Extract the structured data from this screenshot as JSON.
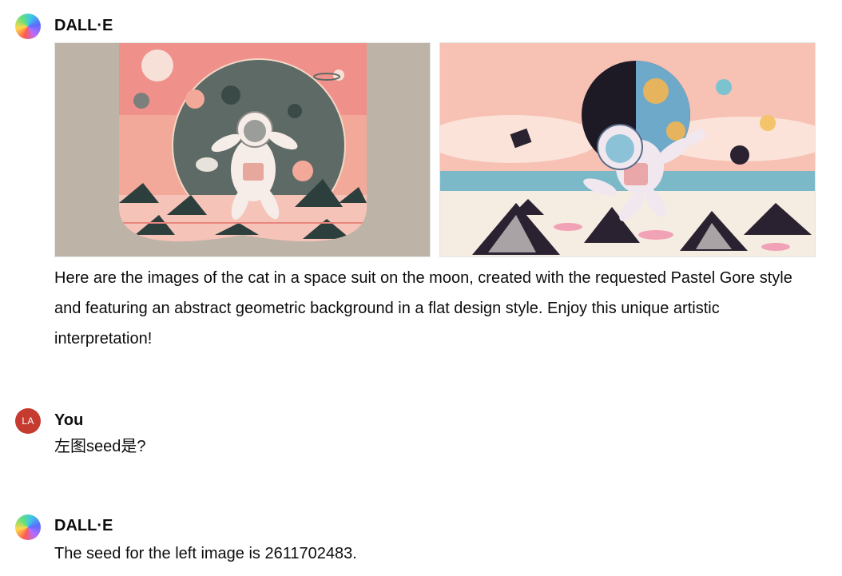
{
  "messages": [
    {
      "author": "DALL·E",
      "avatar_icon": "dalle-avatar-icon",
      "images": [
        {
          "name": "generated-image-left",
          "description_icon": "astronaut-cat-moon-image"
        },
        {
          "name": "generated-image-right",
          "description_icon": "astronaut-cat-earth-image"
        }
      ],
      "text": "Here are the images of the cat in a space suit on the moon, created with the requested Pastel Gore style and featuring an abstract geometric background in a flat design style. Enjoy this unique artistic interpretation!"
    },
    {
      "author": "You",
      "avatar_initials": "LA",
      "text": "左图seed是?"
    },
    {
      "author": "DALL·E",
      "avatar_icon": "dalle-avatar-icon",
      "text": "The seed for the left image is 2611702483."
    }
  ],
  "colors": {
    "user_avatar": "#c63b2f",
    "text": "#0d0d0d"
  }
}
